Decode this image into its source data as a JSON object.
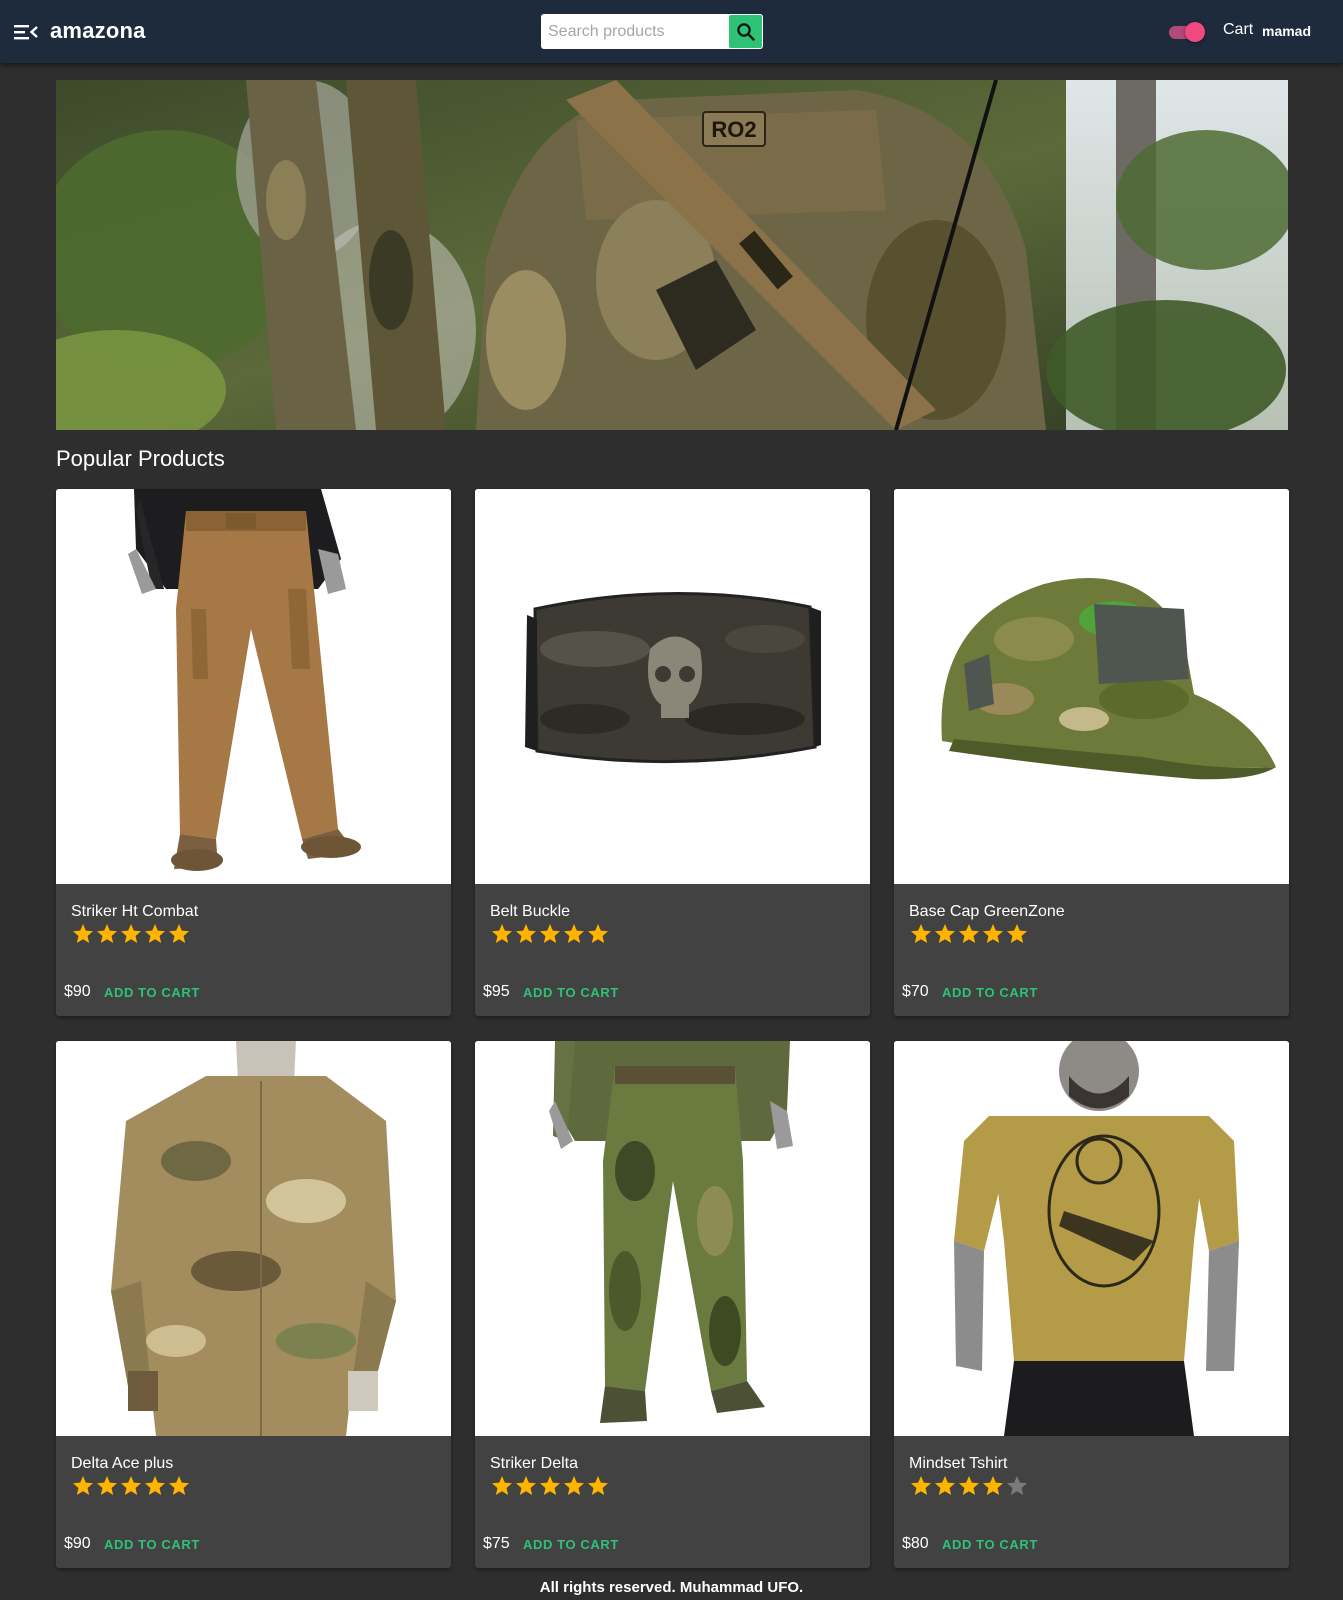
{
  "header": {
    "brand": "amazona",
    "search_placeholder": "Search products",
    "dark_mode_on": true,
    "cart_label": "Cart",
    "user_name": "mamad",
    "accent_color": "#2ec277",
    "bar_color": "#1e2b3c"
  },
  "hero": {
    "icons": [
      "hero-banner-image"
    ],
    "patch_text": "RO2"
  },
  "section": {
    "title": "Popular Products"
  },
  "products": [
    {
      "name": "Striker Ht Combat",
      "rating": 5,
      "price": "$90",
      "action": "ADD TO CART",
      "image": "tan-combat-pants"
    },
    {
      "name": "Belt Buckle",
      "rating": 5,
      "price": "$95",
      "action": "ADD TO CART",
      "image": "camo-skull-face-mask"
    },
    {
      "name": "Base Cap GreenZone",
      "rating": 5,
      "price": "$70",
      "action": "ADD TO CART",
      "image": "green-camo-cap"
    },
    {
      "name": "Delta Ace plus",
      "rating": 5,
      "price": "$90",
      "action": "ADD TO CART",
      "image": "multicam-jacket"
    },
    {
      "name": "Striker Delta",
      "rating": 5,
      "price": "$75",
      "action": "ADD TO CART",
      "image": "multicam-combat-pants"
    },
    {
      "name": "Mindset Tshirt",
      "rating": 4,
      "price": "$80",
      "action": "ADD TO CART",
      "image": "olive-graphic-tshirt"
    }
  ],
  "footer": {
    "text": "All rights reserved. Muhammad UFO."
  }
}
